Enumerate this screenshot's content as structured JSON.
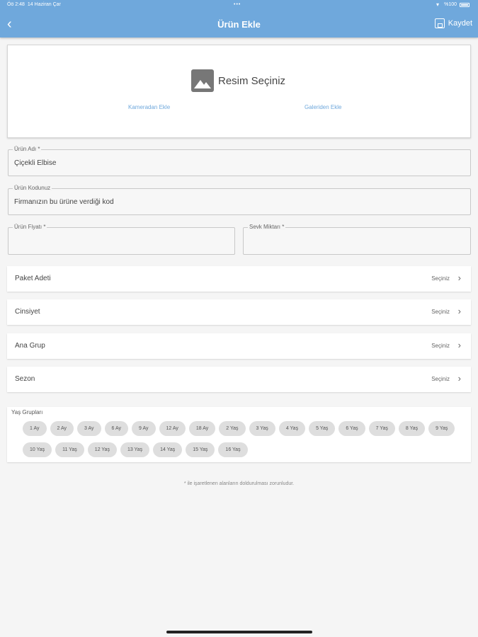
{
  "status_bar": {
    "time": "Öö 2:48",
    "date": "14 Haziran Çar",
    "dots": "•••",
    "battery_pct": "%100"
  },
  "header": {
    "back_icon": "chevron-left-icon",
    "title": "Ürün Ekle",
    "save_label": "Kaydet",
    "save_icon": "save-icon"
  },
  "image_picker": {
    "label": "Resim Seçiniz",
    "camera_link": "Kameradan Ekle",
    "gallery_link": "Galeriden Ekle"
  },
  "fields": {
    "product_name": {
      "label": "Ürün Adı *",
      "value": "Çiçekli Elbise"
    },
    "product_code": {
      "label": "Ürün Kodunuz",
      "value": "Firmanızın bu ürüne verdiği kod"
    },
    "price": {
      "label": "Ürün Fiyatı *",
      "value": ""
    },
    "shipment_qty": {
      "label": "Sevk Miktarı *",
      "value": ""
    }
  },
  "selects": [
    {
      "label": "Paket Adeti",
      "value": "Seçiniz"
    },
    {
      "label": "Cinsiyet",
      "value": "Seçiniz"
    },
    {
      "label": "Ana Grup",
      "value": "Seçiniz"
    },
    {
      "label": "Sezon",
      "value": "Seçiniz"
    }
  ],
  "age_groups": {
    "title": "Yaş Grupları",
    "chips": [
      "1 Ay",
      "2 Ay",
      "3 Ay",
      "6 Ay",
      "9 Ay",
      "12 Ay",
      "18 Ay",
      "2 Yaş",
      "3 Yaş",
      "4 Yaş",
      "5 Yaş",
      "6 Yaş",
      "7 Yaş",
      "8 Yaş",
      "9 Yaş",
      "10 Yaş",
      "11 Yaş",
      "12 Yaş",
      "13 Yaş",
      "14 Yaş",
      "15 Yaş",
      "16 Yaş"
    ]
  },
  "note": "* ile işaretlenen alanların doldurulması zorunludur."
}
